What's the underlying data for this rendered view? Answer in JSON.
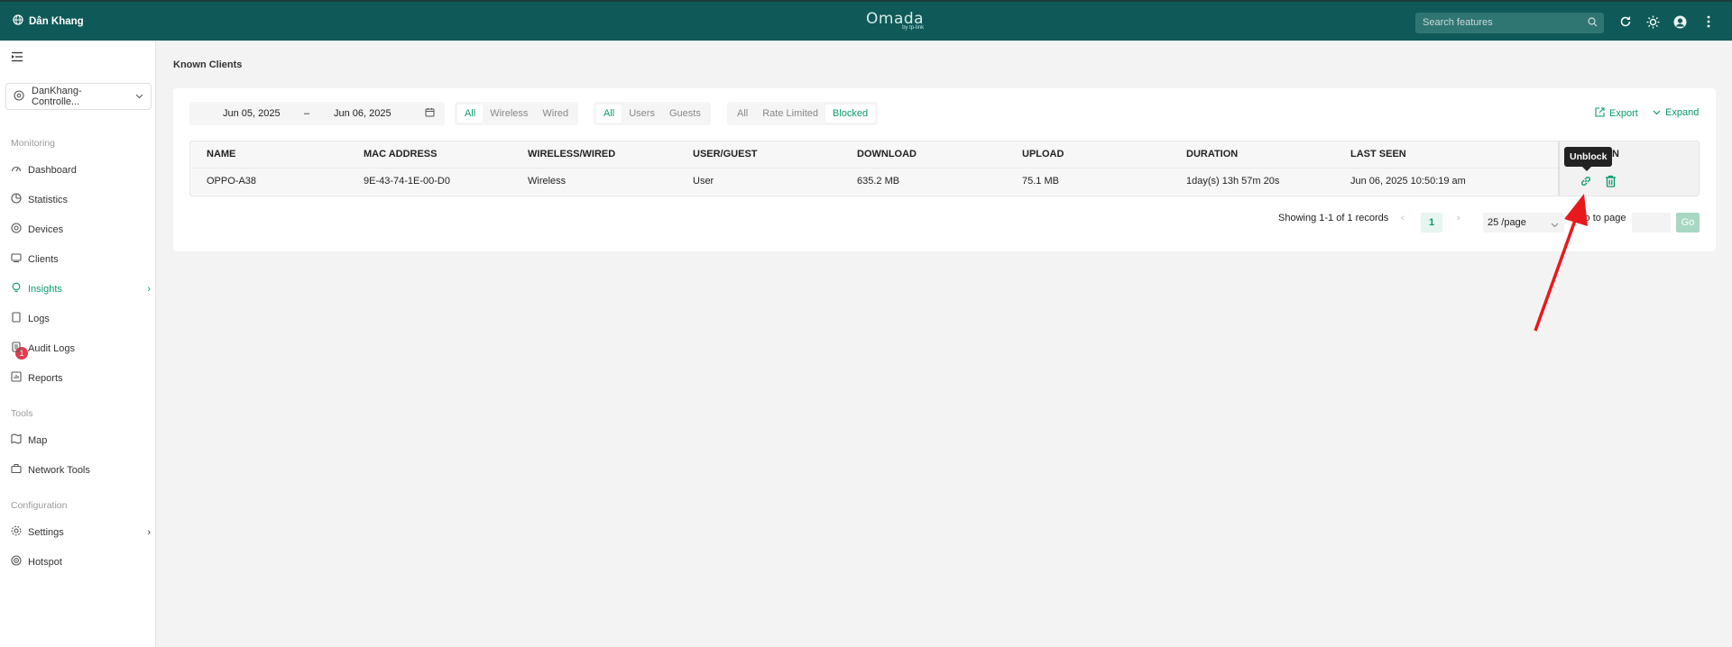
{
  "topbar": {
    "site_name": "Dân Khang",
    "brand": "Omada",
    "brand_sub": "by tp-link",
    "search_placeholder": "Search features"
  },
  "sidebar": {
    "controller": "DanKhang-Controlle...",
    "sections": {
      "monitoring": "Monitoring",
      "tools": "Tools",
      "configuration": "Configuration"
    },
    "items": {
      "dashboard": "Dashboard",
      "statistics": "Statistics",
      "devices": "Devices",
      "clients": "Clients",
      "insights": "Insights",
      "logs": "Logs",
      "audit_logs": "Audit Logs",
      "reports": "Reports",
      "map": "Map",
      "network_tools": "Network Tools",
      "settings": "Settings",
      "hotspot": "Hotspot"
    },
    "logs_badge": "1"
  },
  "main": {
    "title": "Known Clients",
    "date_from": "Jun 05, 2025",
    "date_sep": "–",
    "date_to": "Jun 06, 2025",
    "filter_conn": [
      "All",
      "Wireless",
      "Wired"
    ],
    "filter_user": [
      "All",
      "Users",
      "Guests"
    ],
    "filter_status": [
      "All",
      "Rate Limited",
      "Blocked"
    ],
    "export_label": "Export",
    "expand_label": "Expand",
    "columns": {
      "name": "NAME",
      "mac": "MAC ADDRESS",
      "conn": "WIRELESS/WIRED",
      "user": "USER/GUEST",
      "download": "DOWNLOAD",
      "upload": "UPLOAD",
      "duration": "DURATION",
      "last_seen": "LAST SEEN",
      "action_visible": "N"
    },
    "row": {
      "name": "OPPO-A38",
      "mac": "9E-43-74-1E-00-D0",
      "conn": "Wireless",
      "user": "User",
      "download": "635.2 MB",
      "upload": "75.1 MB",
      "duration": "1day(s) 13h 57m 20s",
      "last_seen": "Jun 06, 2025 10:50:19 am"
    },
    "tooltip": "Unblock",
    "pagination": {
      "summary": "Showing 1-1 of 1 records",
      "current_page": "1",
      "per_page": "25 /page",
      "goto_label": "Go to page",
      "go_button": "Go"
    }
  },
  "colors": {
    "topbar": "#0f5a58",
    "accent": "#0a9a6e",
    "badge": "#e23b4e",
    "annotation_arrow": "#e8191c"
  }
}
